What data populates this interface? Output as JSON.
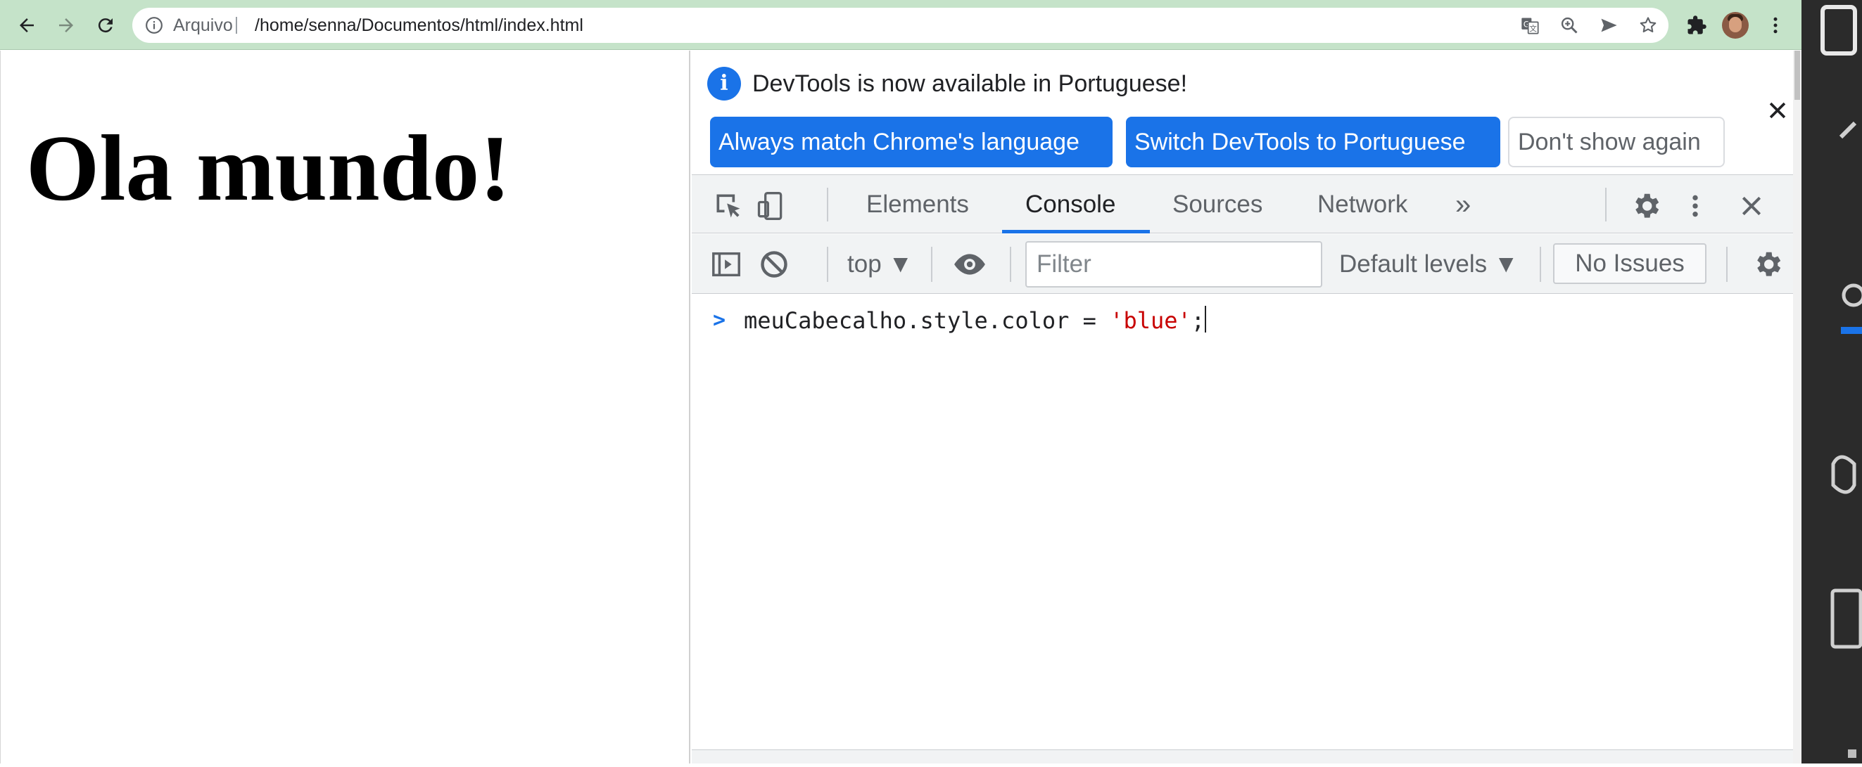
{
  "browser": {
    "scheme_label": "Arquivo",
    "url": "/home/senna/Documentos/html/index.html"
  },
  "page": {
    "heading": "Ola mundo!"
  },
  "devtools": {
    "infobar": {
      "message": "DevTools is now available in Portuguese!",
      "buttons": [
        "Always match Chrome's language",
        "Switch DevTools to Portuguese",
        "Don't show again"
      ]
    },
    "tabs": [
      "Elements",
      "Console",
      "Sources",
      "Network"
    ],
    "active_tab": "Console",
    "more_tabs_glyph": "»",
    "console_toolbar": {
      "context": "top ▼",
      "filter_placeholder": "Filter",
      "levels": "Default levels ▼",
      "issues": "No Issues"
    },
    "console": {
      "prompt": ">",
      "input_pre": "meuCabecalho.style.color = ",
      "input_string": "'blue'",
      "input_post": ";"
    }
  },
  "colors": {
    "toolbar": "#c5e3c9",
    "accent": "#1a73e8",
    "string": "#c80000",
    "panel": "#f1f3f4"
  }
}
